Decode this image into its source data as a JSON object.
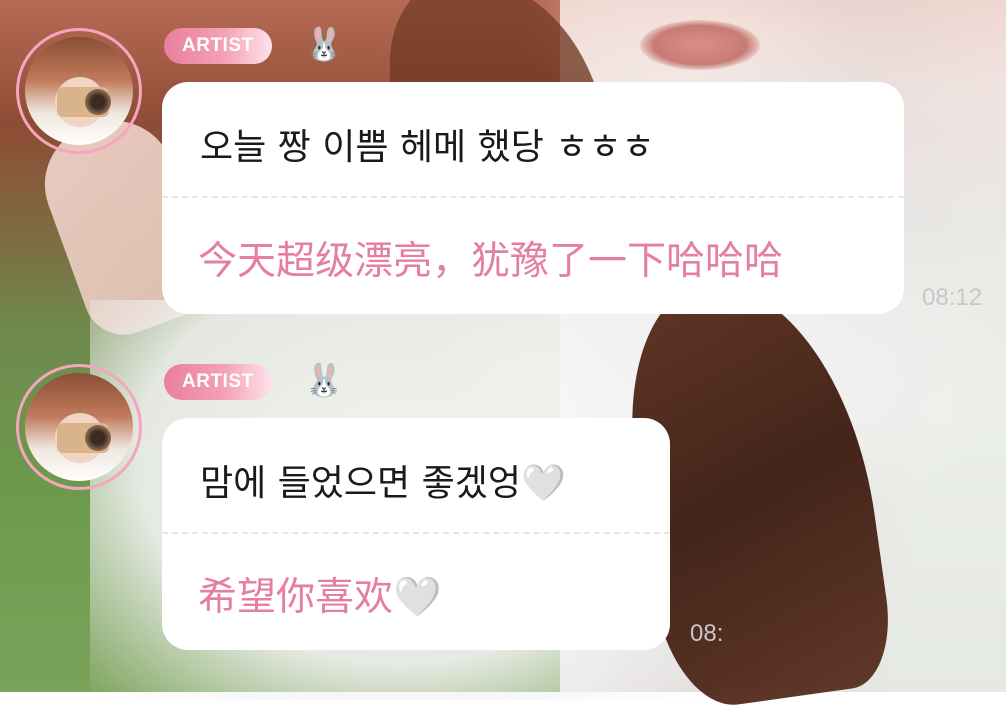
{
  "messages": [
    {
      "badge": "ARTIST",
      "emoji": "🐰",
      "korean": "오늘 짱 이쁨 헤메 했당 ㅎㅎㅎ",
      "translation": "今天超级漂亮，犹豫了一下哈哈哈",
      "time": "08:12"
    },
    {
      "badge": "ARTIST",
      "emoji": "🐰",
      "korean": "맘에 들었으면 좋겠엉🤍",
      "translation": "希望你喜欢🤍",
      "time": "08:"
    }
  ],
  "colors": {
    "badge_pink": "#ea7f9d",
    "translation_pink": "#e47f9f",
    "avatar_ring": "#f4a6bd",
    "bubble_bg": "#ffffff"
  },
  "icons": {
    "emoji_icon": "rabbit-face-icon",
    "avatar": "artist-avatar"
  }
}
